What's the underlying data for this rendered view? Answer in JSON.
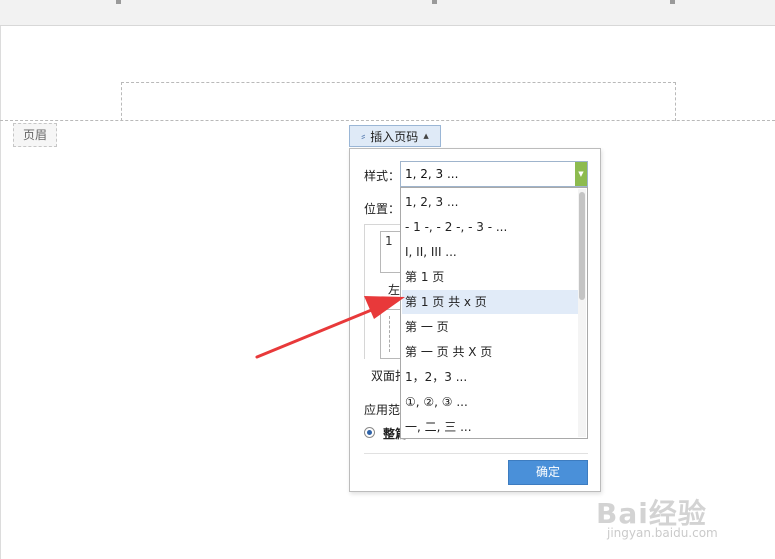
{
  "document": {
    "header_label": "页眉"
  },
  "insert_page_number": {
    "button_label": "插入页码"
  },
  "dialog": {
    "style_label": "样式：",
    "style_value": "1, 2, 3 ...",
    "position_label": "位置：",
    "preview_number": "1",
    "partial_left_label": "左",
    "partial_double_label": "双面打",
    "apply_label_partial": "应用范",
    "apply_option_partial": "整篇",
    "ok_label": "确定"
  },
  "style_options": [
    "1, 2, 3 ...",
    "- 1 -, - 2 -, - 3 - ...",
    "I, II, III ...",
    "第 1 页",
    "第 1 页 共 x 页",
    "第 一 页",
    "第 一 页 共 X 页",
    "1，2，3 ...",
    "①, ②, ③ ...",
    "一, 二, 三 ..."
  ],
  "highlighted_option": "第 1 页 共 x 页",
  "annotation": {
    "arrow_color": "#e8393a"
  },
  "watermark": {
    "logo": "Bai经验",
    "url": "jingyan.baidu.com"
  }
}
